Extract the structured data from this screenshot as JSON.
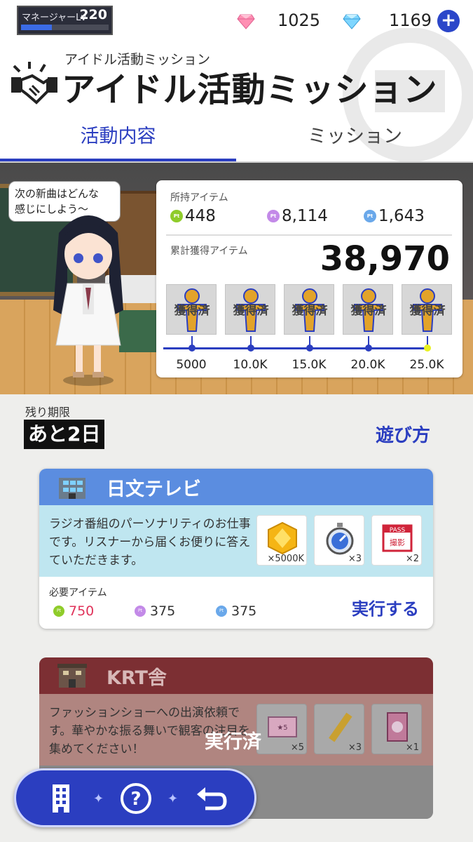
{
  "top_bar": {
    "manager_label": "マネージャーLv",
    "manager_level": "220",
    "manager_progress": 0.35,
    "currency_pink": "1025",
    "currency_blue": "1169",
    "plus_label": "+"
  },
  "header": {
    "subtitle": "アイドル活動ミッション",
    "title": "アイドル活動ミッション"
  },
  "tabs": [
    {
      "label": "活動内容",
      "active": true
    },
    {
      "label": "ミッション",
      "active": false
    }
  ],
  "scene": {
    "speech": "次の新曲はどんな\n感じにしよう～"
  },
  "items_panel": {
    "owned_label": "所持アイテム",
    "owned": [
      {
        "icon": "pt-green",
        "value": "448"
      },
      {
        "icon": "pt-purple",
        "value": "8,114"
      },
      {
        "icon": "pt-blue",
        "value": "1,643"
      }
    ],
    "total_label": "累計獲得アイテム",
    "total_value": "38,970",
    "rewards": [
      {
        "status": "獲得済",
        "milestone": "5000"
      },
      {
        "status": "獲得済",
        "milestone": "10.0K"
      },
      {
        "status": "獲得済",
        "milestone": "15.0K"
      },
      {
        "status": "獲得済",
        "milestone": "20.0K"
      },
      {
        "status": "獲得済",
        "milestone": "25.0K"
      }
    ]
  },
  "deadline": {
    "label": "残り期限",
    "value": "あと2日"
  },
  "howto_label": "遊び方",
  "missions": [
    {
      "name": "日文テレビ",
      "description": "ラジオ番組のパーソナリティのお仕事です。リスナーから届くお便りに答えていただきます。",
      "rewards": [
        {
          "icon": "gem-box-icon",
          "qty": "×5000K"
        },
        {
          "icon": "stopwatch-icon",
          "qty": "×3"
        },
        {
          "icon": "pass-ticket-icon",
          "qty": "×2"
        }
      ],
      "required_label": "必要アイテム",
      "required": [
        {
          "icon": "pt-green",
          "value": "750",
          "color": "#e0335a"
        },
        {
          "icon": "pt-purple",
          "value": "375",
          "color": "#333333"
        },
        {
          "icon": "pt-blue",
          "value": "375",
          "color": "#333333"
        }
      ],
      "action": "実行する"
    },
    {
      "name": "KRT舎",
      "description": "ファッションショーへの出演依頼です。華やかな振る舞いで観客の注目を集めてください！",
      "rewards": [
        {
          "icon": "ticket-icon",
          "qty": "×5"
        },
        {
          "icon": "stick-icon",
          "qty": "×3"
        },
        {
          "icon": "sparkle-card-icon",
          "qty": "×1"
        }
      ],
      "status": "実行済"
    }
  ],
  "nav": {
    "pass_label": "PASS",
    "photo_label": "撮影"
  }
}
